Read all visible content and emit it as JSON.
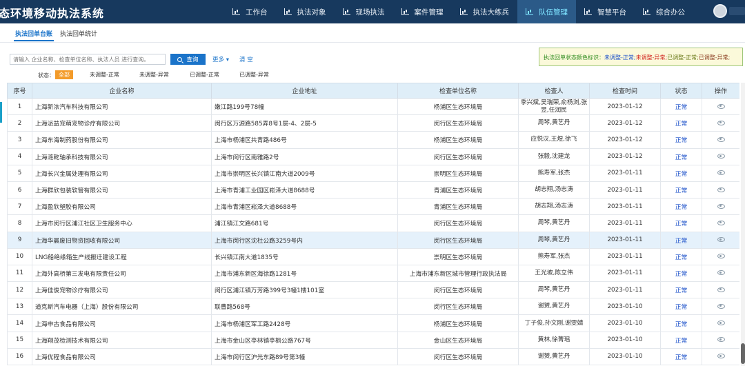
{
  "app": {
    "title": "态环境移动执法系统"
  },
  "nav": [
    {
      "label": "工作台",
      "active": false
    },
    {
      "label": "执法对象",
      "active": false
    },
    {
      "label": "现场执法",
      "active": false
    },
    {
      "label": "案件管理",
      "active": false
    },
    {
      "label": "执法大练兵",
      "active": false
    },
    {
      "label": "队伍管理",
      "active": true
    },
    {
      "label": "智慧平台",
      "active": false
    },
    {
      "label": "综合办公",
      "active": false
    }
  ],
  "tabs": [
    {
      "label": "执法回单台账",
      "active": true
    },
    {
      "label": "执法回单统计",
      "active": false
    }
  ],
  "search": {
    "placeholder": "请输入 企业名称、检查单位名称、执法人员 进行查询。",
    "button": "查询",
    "more": "更多 ▾",
    "clear": "清 空"
  },
  "legend": {
    "prefix": "执法回单状态颜色标识：",
    "items": [
      "未调整-正常;",
      "未调整-异常;",
      "已调整-正常;",
      "已调整-异常;"
    ]
  },
  "status_filter": {
    "label": "状态：",
    "options": [
      "全部",
      "未调整-正常",
      "未调整-异常",
      "已调整-正常",
      "已调整-异常"
    ]
  },
  "table": {
    "headers": [
      "序号",
      "企业名称",
      "企业地址",
      "检查单位名称",
      "检查人",
      "检查时间",
      "状态",
      "操作"
    ],
    "rows": [
      {
        "no": "1",
        "name": "上海新浓汽车科技有限公司",
        "addr": "嫩江路199号78幢",
        "unit": "杨浦区生态环境局",
        "inspector": "季兴斌,吴瑞荣,俞杨浏,张昱,任润民",
        "date": "2023-01-12",
        "status": "正常"
      },
      {
        "no": "2",
        "name": "上海派益宠萌宠物诊疗有限公司",
        "addr": "闵行区万源路585弄8号1层-4、2层-5",
        "unit": "闵行区生态环境局",
        "inspector": "周琴,黄艺丹",
        "date": "2023-01-12",
        "status": "正常"
      },
      {
        "no": "3",
        "name": "上海东海制药股份有限公司",
        "addr": "上海市杨浦区共青路486号",
        "unit": "杨浦区生态环境局",
        "inspector": "应悦汉,王煜,徐飞",
        "date": "2023-01-12",
        "status": "正常"
      },
      {
        "no": "4",
        "name": "上海涟乾轴承科技有限公司",
        "addr": "上海市闵行区南雅路2号",
        "unit": "闵行区生态环境局",
        "inspector": "张毅,沈建龙",
        "date": "2023-01-12",
        "status": "正常"
      },
      {
        "no": "5",
        "name": "上海长兴金属处理有限公司",
        "addr": "上海市崇明区长兴镇江南大道2009号",
        "unit": "崇明区生态环境局",
        "inspector": "熊寿军,张杰",
        "date": "2023-01-11",
        "status": "正常"
      },
      {
        "no": "6",
        "name": "上海群欣包装软管有限公司",
        "addr": "上海市青浦工业园区崧泽大道8688号",
        "unit": "青浦区生态环境局",
        "inspector": "胡志翔,汤志涛",
        "date": "2023-01-11",
        "status": "正常"
      },
      {
        "no": "7",
        "name": "上海盈欣塑胶有限公司",
        "addr": "上海市青浦区崧泽大道8688号",
        "unit": "青浦区生态环境局",
        "inspector": "胡志翔,汤志涛",
        "date": "2023-01-11",
        "status": "正常"
      },
      {
        "no": "8",
        "name": "上海市闵行区浦江社区卫生服务中心",
        "addr": "浦江镇江文路681号",
        "unit": "闵行区生态环境局",
        "inspector": "周琴,黄艺丹",
        "date": "2023-01-11",
        "status": "正常"
      },
      {
        "no": "9",
        "name": "上海华晨废旧物资回收有限公司",
        "addr": "上海市闵行区沈杜公路3259号内",
        "unit": "闵行区生态环境局",
        "inspector": "周琴,黄艺丹",
        "date": "2023-01-11",
        "status": "正常",
        "highlight": true
      },
      {
        "no": "10",
        "name": "LNG船绝缘箱生产线搬迁建设工程",
        "addr": "长兴镇江南大道1835号",
        "unit": "崇明区生态环境局",
        "inspector": "熊寿军,张杰",
        "date": "2023-01-11",
        "status": "正常"
      },
      {
        "no": "11",
        "name": "上海外高桥第三发电有限责任公司",
        "addr": "上海市浦东新区海徐路1281号",
        "unit": "上海市浦东新区城市管理行政执法局",
        "inspector": "王光坡,陈立伟",
        "date": "2023-01-11",
        "status": "正常"
      },
      {
        "no": "12",
        "name": "上海佳俊宠物诊疗有限公司",
        "addr": "闵行区浦江镇万芳路399号3幢1楼101室",
        "unit": "闵行区生态环境局",
        "inspector": "周琴,黄艺丹",
        "date": "2023-01-11",
        "status": "正常"
      },
      {
        "no": "13",
        "name": "道克斯汽车电器（上海）股份有限公司",
        "addr": "联曹路568号",
        "unit": "闵行区生态环境局",
        "inspector": "谢赟,黄艺丹",
        "date": "2023-01-10",
        "status": "正常"
      },
      {
        "no": "14",
        "name": "上海申古食品有限公司",
        "addr": "上海市杨浦区军工路2428号",
        "unit": "杨浦区生态环境局",
        "inspector": "丁子俊,孙文刚,谢雯婧",
        "date": "2023-01-10",
        "status": "正常"
      },
      {
        "no": "15",
        "name": "上海翔茂检测技术有限公司",
        "addr": "上海市金山区亭林镇亭枫公路767号",
        "unit": "金山区生态环境局",
        "inspector": "黄林,徐菁瑶",
        "date": "2023-01-10",
        "status": "正常"
      },
      {
        "no": "16",
        "name": "上海优程食品有限公司",
        "addr": "上海市闵行区沪光东路89号第3幢",
        "unit": "闵行区生态环境局",
        "inspector": "谢赟,黄艺丹",
        "date": "2023-01-10",
        "status": "正常"
      }
    ]
  },
  "colors": {
    "topbar": "#17395e",
    "nav_active_bg": "#2b5a88",
    "accent": "#1a73c9",
    "status_link": "#1a4fc9",
    "filter_active": "#f39b2a",
    "header_bg": "#dfeef8",
    "legend_bg": "#fbf9da"
  }
}
